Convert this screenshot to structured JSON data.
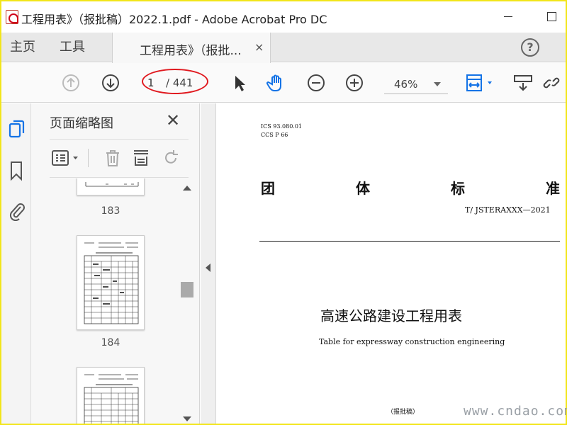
{
  "window": {
    "title": "工程用表》（报批稿）2022.1.pdf - Adobe Acrobat Pro DC"
  },
  "nav": {
    "home": "主页",
    "tools": "工具"
  },
  "doc_tab": {
    "label": "工程用表》（报批...",
    "close": "×"
  },
  "toolbar": {
    "page_current": "1",
    "page_total": "/ 441",
    "zoom": "46%"
  },
  "panel": {
    "title": "页面缩略图",
    "close": "✕",
    "thumbnails": [
      {
        "label": "183"
      },
      {
        "label": "184"
      }
    ]
  },
  "document": {
    "ics": "ICS  93.080.01",
    "ccs": "CCS P 66",
    "heading_chars": [
      "团",
      "体",
      "标",
      "准"
    ],
    "standard_no": "T/ JSTERAXXX—2021",
    "main_title": "高速公路建设工程用表",
    "subtitle": "Table for expressway construction engineering",
    "draft_label": "（报批稿）"
  },
  "watermark": "www.cndao.com",
  "colors": {
    "accent_blue": "#1473e6",
    "frame_yellow": "#f2e51a",
    "annotation_red": "#e0191f"
  }
}
